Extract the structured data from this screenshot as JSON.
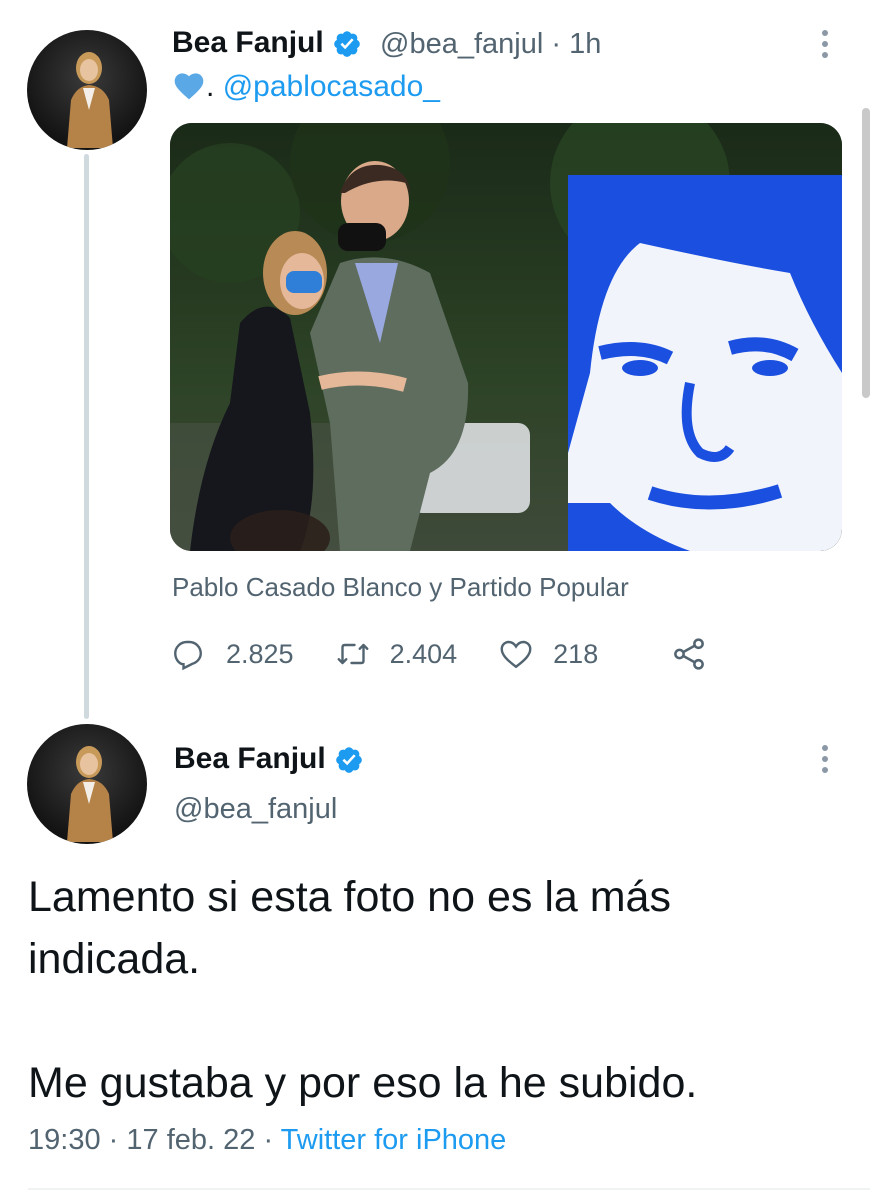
{
  "tweet1": {
    "display_name": "Bea Fanjul",
    "handle": "@bea_fanjul",
    "separator": "·",
    "time": "1h",
    "text_prefix": ".",
    "mention": "@pablocasado_",
    "caption": "Pablo Casado Blanco y Partido Popular",
    "replies": "2.825",
    "retweets": "2.404",
    "likes": "218"
  },
  "tweet2": {
    "display_name": "Bea Fanjul",
    "handle": "@bea_fanjul",
    "text_line1": "Lamento si esta foto no es la más indicada.",
    "text_line2": "Me gustaba y por eso la he subido.",
    "time": "19:30",
    "sep1": "·",
    "date": "17 feb. 22",
    "sep2": "·",
    "source": "Twitter for iPhone"
  },
  "icons": [
    "verified-badge-icon",
    "more-options-icon",
    "blue-heart-icon",
    "reply-icon",
    "retweet-icon",
    "like-icon",
    "share-icon"
  ],
  "colors": {
    "accent": "#1d9bf0",
    "secondary_text": "#536471",
    "primary_text": "#0f1419"
  }
}
